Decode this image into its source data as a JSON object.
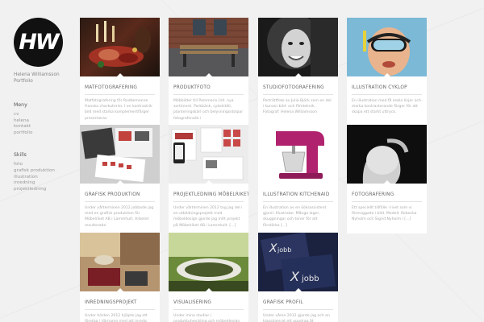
{
  "logo": {
    "text": "HW"
  },
  "owner": {
    "name": "Helena Williamsson",
    "subtitle": "Portfolio"
  },
  "menu": {
    "heading": "Meny",
    "items": [
      {
        "label": "cv"
      },
      {
        "label": "helena"
      },
      {
        "label": "kontakt"
      },
      {
        "label": "portfolio"
      }
    ]
  },
  "skills": {
    "heading": "Skills",
    "items": [
      {
        "label": "foto"
      },
      {
        "label": "grafisk produktion"
      },
      {
        "label": "illustration"
      },
      {
        "label": "inredning"
      },
      {
        "label": "projektledning"
      }
    ]
  },
  "cards": [
    {
      "title": "MATFOTOGRAFERING",
      "desc": "Matfotografering för Roddemenne franska charkuterier. I en kontrastrik bild med starka komplementfärger presenteras"
    },
    {
      "title": "PRODUKTFOTO",
      "desc": "Möbbilder till Pommerix Ltd. nya sortiment. Parkbänk, cykelställ, planteringskärl och belysningsstolpar fotograferade i"
    },
    {
      "title": "STUDIOFOTOGRAFERING",
      "desc": "Porträttfoto av Julia Björk som en del i kursen bild- och filmteknik. Fotograf: Helena Williamsson"
    },
    {
      "title": "ILLUSTRATION CYKLOP",
      "desc": "En illustration med få enkla linjer och starka kontrasterande färger för att skapa ett starkt uttryck."
    },
    {
      "title": "GRAFISK PRODUKTION",
      "desc": "Under vårterminen 2012 jobbade jag med en grafisk produktion för Möbelriket AB i Lammhult. Arbetet resulterade"
    },
    {
      "title": "PROJEKTLEDNING MÖBELRIKET",
      "desc": "Under vårterminen 2012 tog jag del i en utbildningsprojekt med möbeldesign gjorde jag mitt projekt på Möbelriket AB i Lammhult. [...]"
    },
    {
      "title": "ILLUSTRATION KITCHENAID",
      "desc": "En illustration av en köksassistent gjord i Illustrator. Många lager, skuggningar och toner för att förstärka [...]"
    },
    {
      "title": "FOTOGRAFERING",
      "desc": "Ett speciellt tillfälle i livet som vi föreviggade i bild. Modell: Rebecka Nyholm och Sigrid Nyholm i [...]"
    },
    {
      "title": "INREDNINGSPROJEKT",
      "desc": "Under hösten 2012 hjälpte jag ett företag i Värnamo med att inreda"
    },
    {
      "title": "VISUALISERING",
      "desc": "Under mina studier i produktutveckling och möbeldesign"
    },
    {
      "title": "GRAFISK PROFIL",
      "desc": "Under våren 2012 gjorde jag och en klasskamrat ett uppdrag åt"
    }
  ],
  "thumb_texts": {
    "jobb_logo": "jobb",
    "jobb_x": "X"
  },
  "colors": {
    "background": "#f1f1f1",
    "card": "#ffffff",
    "logo": "#111111"
  }
}
